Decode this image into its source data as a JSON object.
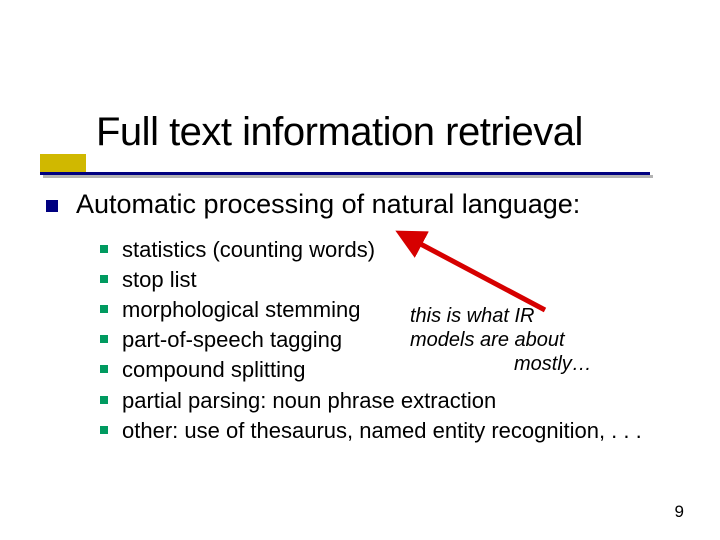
{
  "title": "Full text information retrieval",
  "level1": "Automatic processing of natural language:",
  "items": [
    "statistics (counting words)",
    "stop list",
    "morphological stemming",
    "part-of-speech tagging",
    "compound splitting",
    "partial parsing: noun phrase extraction",
    "other: use of thesaurus, named entity recognition, . . ."
  ],
  "annotation": {
    "line1": "this is what IR",
    "line2": "models are about",
    "line3": "mostly…"
  },
  "pagenum": "9",
  "colors": {
    "bullet_primary": "#000080",
    "bullet_secondary": "#009a60",
    "accent_bar": "#d0b800",
    "arrow": "#d60000"
  }
}
